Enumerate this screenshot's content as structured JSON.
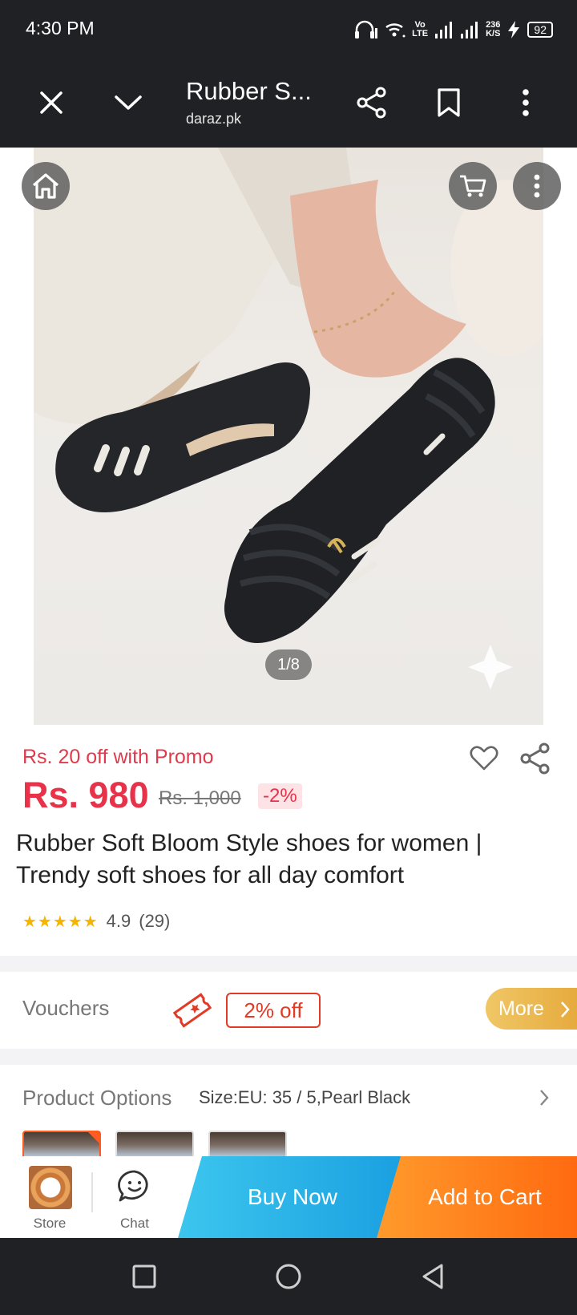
{
  "status_bar": {
    "time": "4:30 PM",
    "network_top": "Vo",
    "network_bottom": "LTE",
    "speed_top": "236",
    "speed_bottom": "K/S",
    "battery": "92"
  },
  "browser": {
    "title": "Rubber S...",
    "domain": "daraz.pk",
    "icons": [
      "close-icon",
      "chevron-down-icon",
      "share-icon",
      "bookmark-icon",
      "more-vert-icon"
    ]
  },
  "gallery": {
    "counter": "1/8",
    "icons": [
      "home-icon",
      "cart-icon",
      "more-vert-icon"
    ]
  },
  "product": {
    "promo": "Rs. 20 off with Promo",
    "price": "Rs. 980",
    "original_price": "Rs. 1,000",
    "discount": "-2%",
    "title": "Rubber Soft Bloom Style shoes for women | Trendy soft shoes for all day comfort",
    "stars": "★★★★★",
    "rating": "4.9",
    "review_count": "(29)"
  },
  "vouchers": {
    "label": "Vouchers",
    "tag": "2% off",
    "more": "More"
  },
  "options": {
    "label": "Product Options",
    "value": "Size:EU: 35 / 5,Pearl Black"
  },
  "bottom_bar": {
    "store": "Store",
    "chat": "Chat",
    "buy_now": "Buy Now",
    "add_to_cart": "Add to Cart"
  },
  "colors": {
    "accent_red": "#e8324a",
    "buy_now": "#1a9fe0",
    "add_to_cart": "#ff6a10",
    "voucher": "#e23a25"
  }
}
